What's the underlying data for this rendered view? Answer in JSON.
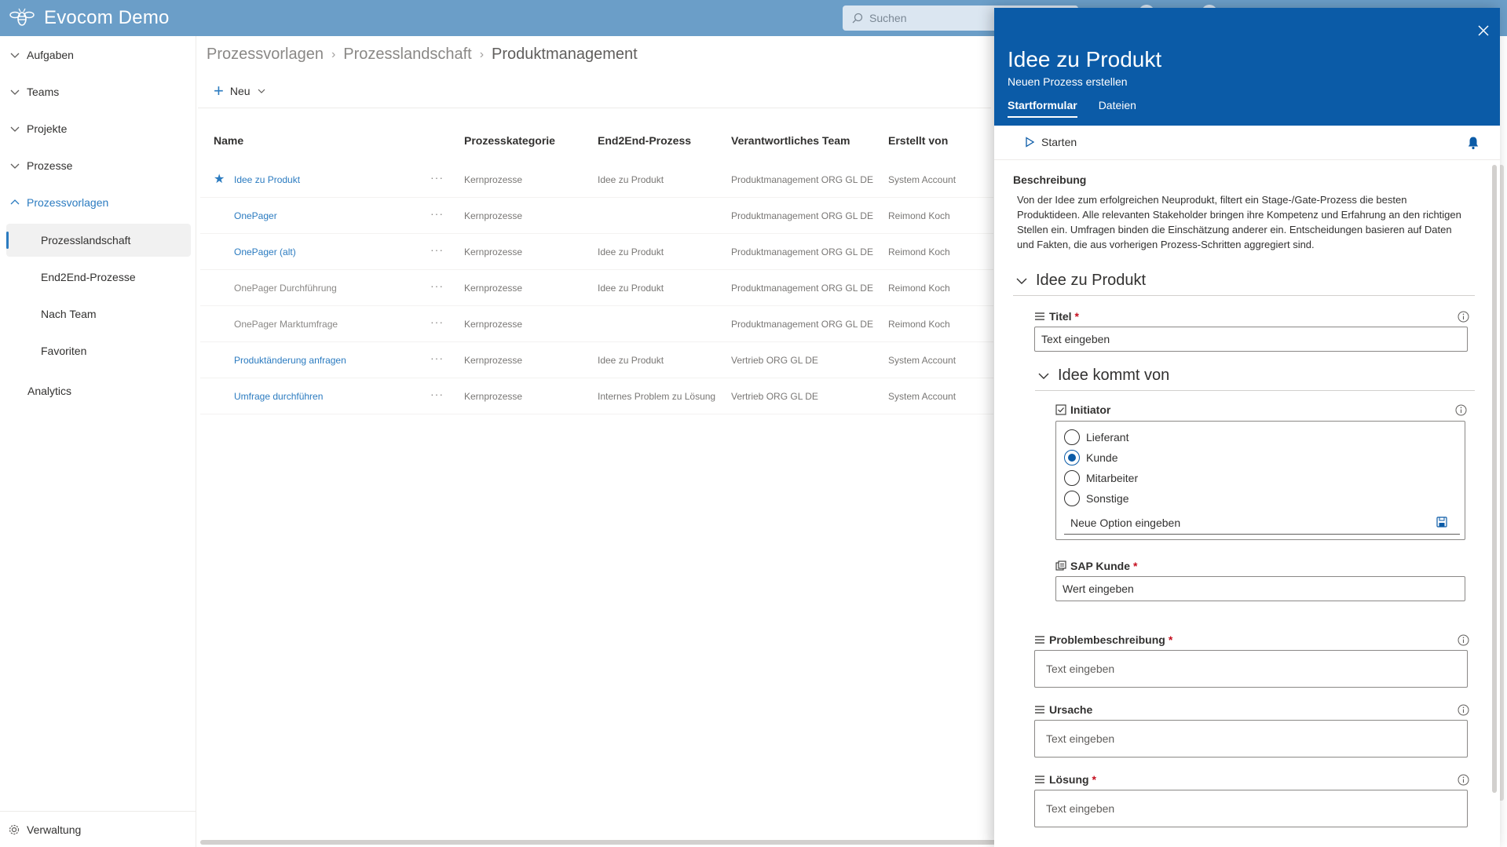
{
  "app": {
    "title": "Evocom Demo",
    "search_placeholder": "Suchen"
  },
  "sidebar": {
    "items": [
      {
        "label": "Aufgaben"
      },
      {
        "label": "Teams"
      },
      {
        "label": "Projekte"
      },
      {
        "label": "Prozesse"
      },
      {
        "label": "Prozessvorlagen"
      }
    ],
    "subitems": [
      {
        "label": "Prozesslandschaft"
      },
      {
        "label": "End2End-Prozesse"
      },
      {
        "label": "Nach Team"
      },
      {
        "label": "Favoriten"
      }
    ],
    "analytics": "Analytics",
    "admin": "Verwaltung"
  },
  "breadcrumb": [
    "Prozessvorlagen",
    "Prozesslandschaft",
    "Produktmanagement"
  ],
  "toolbar": {
    "new_label": "Neu"
  },
  "table": {
    "headers": [
      "Name",
      "Prozesskategorie",
      "End2End-Prozess",
      "Verantwortliches Team",
      "Erstellt von"
    ],
    "rows": [
      {
        "name": "Idee zu Produkt",
        "category": "Kernprozesse",
        "e2e": "Idee zu Produkt",
        "team": "Produktmanagement ORG GL DE",
        "creator": "System Account"
      },
      {
        "name": "OnePager",
        "category": "Kernprozesse",
        "e2e": "",
        "team": "Produktmanagement ORG GL DE",
        "creator": "Reimond Koch"
      },
      {
        "name": "OnePager (alt)",
        "category": "Kernprozesse",
        "e2e": "Idee zu Produkt",
        "team": "Produktmanagement ORG GL DE",
        "creator": "Reimond Koch"
      },
      {
        "name": "OnePager Durchführung",
        "category": "Kernprozesse",
        "e2e": "Idee zu Produkt",
        "team": "Produktmanagement ORG GL DE",
        "creator": "Reimond Koch"
      },
      {
        "name": "OnePager Marktumfrage",
        "category": "Kernprozesse",
        "e2e": "",
        "team": "Produktmanagement ORG GL DE",
        "creator": "Reimond Koch"
      },
      {
        "name": "Produktänderung anfragen",
        "category": "Kernprozesse",
        "e2e": "Idee zu Produkt",
        "team": "Vertrieb ORG GL DE",
        "creator": "System Account"
      },
      {
        "name": "Umfrage durchführen",
        "category": "Kernprozesse",
        "e2e": "Internes Problem zu Lösung",
        "team": "Vertrieb ORG GL DE",
        "creator": "System Account"
      }
    ]
  },
  "panel": {
    "title": "Idee zu Produkt",
    "subtitle": "Neuen Prozess erstellen",
    "tabs": [
      "Startformular",
      "Dateien"
    ],
    "start_label": "Starten",
    "description_label": "Beschreibung",
    "description": "Von der Idee zum erfolgreichen Neuprodukt, filtert ein Stage-/Gate-Prozess die besten Produktideen. Alle relevanten Stakeholder bringen ihre Kompetenz und Erfahrung an den richtigen Stellen ein. Umfragen binden die Einschätzung anderer ein. Entscheidungen basieren auf Daten und Fakten, die aus vorherigen Prozess-Schritten aggregiert sind.",
    "section1": "Idee zu Produkt",
    "title_field": {
      "label": "Titel",
      "placeholder": "Text eingeben"
    },
    "section2": "Idee kommt von",
    "initiator": {
      "label": "Initiator",
      "options": [
        "Lieferant",
        "Kunde",
        "Mitarbeiter",
        "Sonstige"
      ],
      "selected": "Kunde",
      "new_option_placeholder": "Neue Option eingeben"
    },
    "sap_field": {
      "label": "SAP Kunde",
      "placeholder": "Wert eingeben"
    },
    "problem_field": {
      "label": "Problembeschreibung",
      "placeholder": "Text eingeben"
    },
    "cause_field": {
      "label": "Ursache",
      "placeholder": "Text eingeben"
    },
    "solution_field": {
      "label": "Lösung",
      "placeholder": "Text eingeben"
    },
    "required_mark": "*"
  },
  "colors": {
    "topbar": "#6b9ec8",
    "panel_header": "#0b5ba7",
    "accent": "#2b7bc0",
    "required": "#c50f1f"
  }
}
